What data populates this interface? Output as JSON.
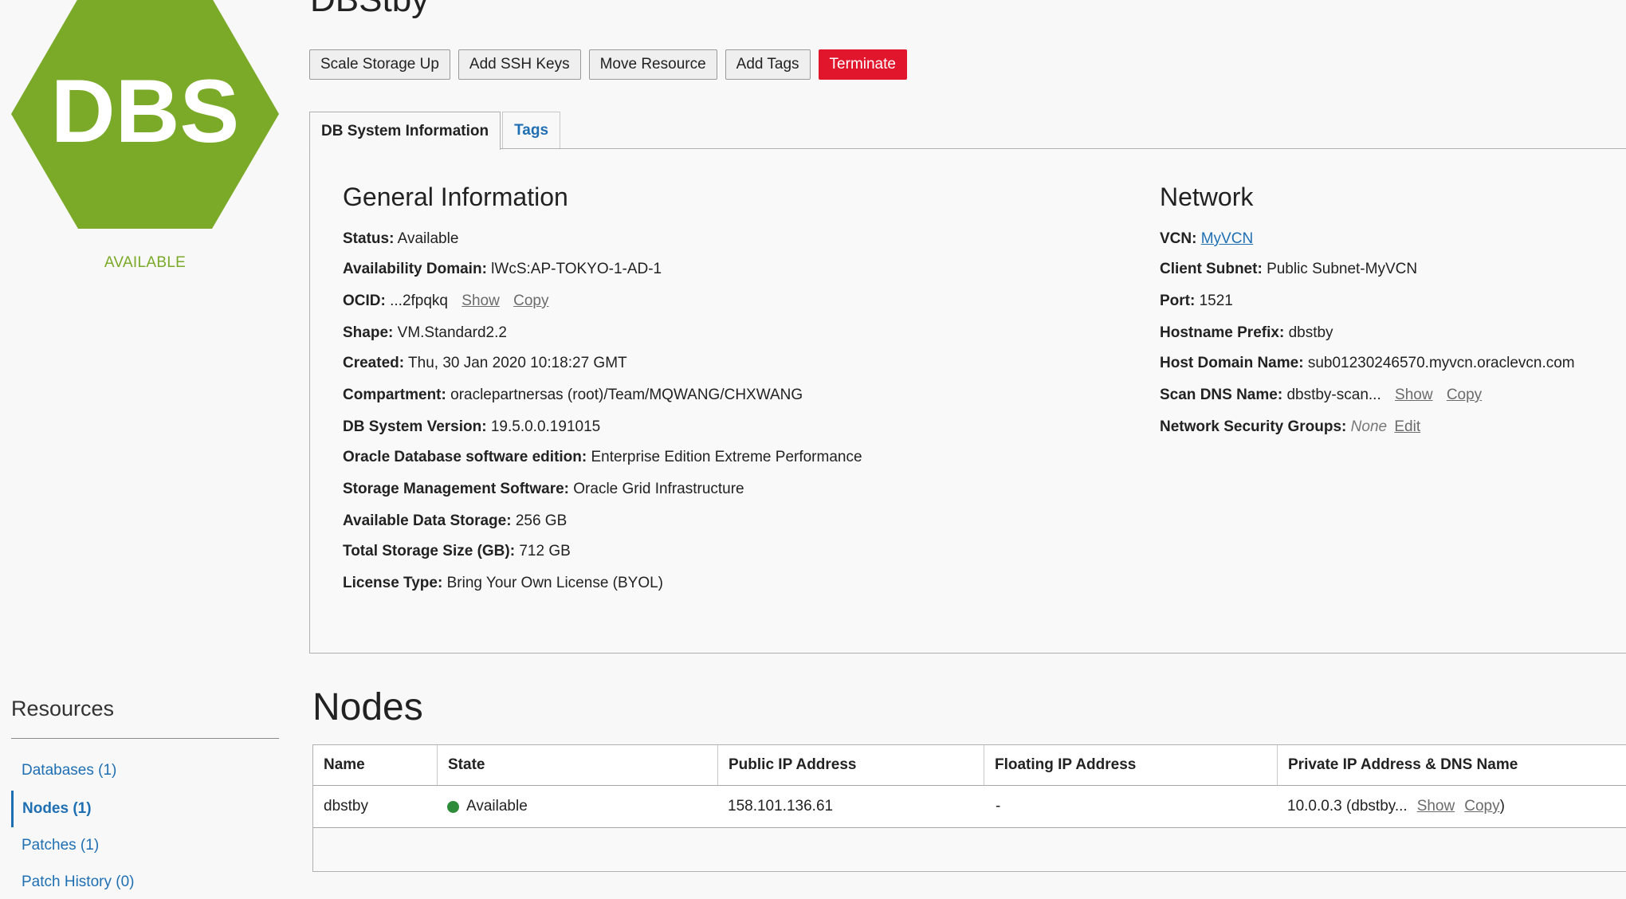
{
  "page": {
    "title": "DBStby"
  },
  "logo": {
    "text": "DBS",
    "status": "AVAILABLE",
    "color": "#7aaa28"
  },
  "actions": {
    "scale_storage": "Scale Storage Up",
    "add_ssh_keys": "Add SSH Keys",
    "move_resource": "Move Resource",
    "add_tags": "Add Tags",
    "terminate": "Terminate"
  },
  "tabs": [
    {
      "label": "DB System Information",
      "active": true
    },
    {
      "label": "Tags",
      "active": false
    }
  ],
  "general": {
    "title": "General Information",
    "show": "Show",
    "copy": "Copy",
    "rows": [
      {
        "label": "Status:",
        "value": "Available"
      },
      {
        "label": "Availability Domain:",
        "value": "lWcS:AP-TOKYO-1-AD-1"
      },
      {
        "label": "OCID:",
        "value": "...2fpqkq"
      },
      {
        "label": "Shape:",
        "value": "VM.Standard2.2"
      },
      {
        "label": "Created:",
        "value": "Thu, 30 Jan 2020 10:18:27 GMT"
      },
      {
        "label": "Compartment:",
        "value": "oraclepartnersas (root)/Team/MQWANG/CHXWANG"
      },
      {
        "label": "DB System Version:",
        "value": "19.5.0.0.191015"
      },
      {
        "label": "Oracle Database software edition:",
        "value": "Enterprise Edition Extreme Performance"
      },
      {
        "label": "Storage Management Software:",
        "value": "Oracle Grid Infrastructure"
      },
      {
        "label": "Available Data Storage:",
        "value": "256 GB"
      },
      {
        "label": "Total Storage Size (GB):",
        "value": "712 GB"
      },
      {
        "label": "License Type:",
        "value": "Bring Your Own License (BYOL)"
      }
    ]
  },
  "network": {
    "title": "Network",
    "show": "Show",
    "copy": "Copy",
    "edit": "Edit",
    "rows": [
      {
        "label": "VCN:",
        "value": "MyVCN"
      },
      {
        "label": "Client Subnet:",
        "value": "Public Subnet-MyVCN"
      },
      {
        "label": "Port:",
        "value": "1521"
      },
      {
        "label": "Hostname Prefix:",
        "value": "dbstby"
      },
      {
        "label": "Host Domain Name:",
        "value": "sub01230246570.myvcn.oraclevcn.com"
      },
      {
        "label": "Scan DNS Name:",
        "value": "dbstby-scan..."
      },
      {
        "label": "Network Security Groups:",
        "value": "None"
      }
    ]
  },
  "resources": {
    "title": "Resources",
    "items": [
      {
        "label": "Databases (1)",
        "active": false
      },
      {
        "label": "Nodes (1)",
        "active": true
      },
      {
        "label": "Patches (1)",
        "active": false
      },
      {
        "label": "Patch History (0)",
        "active": false
      }
    ]
  },
  "nodes": {
    "title": "Nodes",
    "columns": [
      "Name",
      "State",
      "Public IP Address",
      "Floating IP Address",
      "Private IP Address & DNS Name"
    ],
    "rows": [
      {
        "name": "dbstby",
        "state": "Available",
        "state_color": "#2e8b3a",
        "public_ip": "158.101.136.61",
        "floating_ip": "-",
        "private_ip": "10.0.0.3 (dbstby...",
        "show": "Show",
        "copy": "Copy",
        "close_paren": ")"
      }
    ]
  }
}
